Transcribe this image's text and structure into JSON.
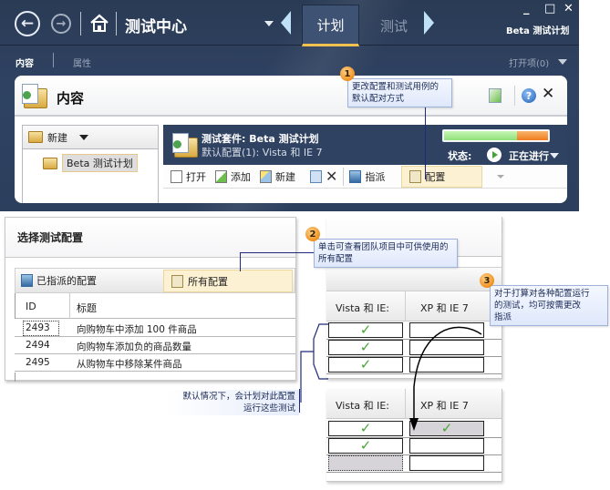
{
  "titlebar": {
    "back_icon": "arrow-left-circle-icon",
    "forward_icon": "arrow-right-circle-icon",
    "home_icon": "home-icon",
    "app_title": "测试中心",
    "tabs": [
      {
        "label": "计划",
        "active": true
      },
      {
        "label": "测试",
        "active": false
      }
    ],
    "window_controls": {
      "minimize": "_",
      "maximize": "□",
      "close": "✕"
    },
    "plan_name": "Beta 测试计划"
  },
  "subnav": {
    "tabs": [
      {
        "label": "内容",
        "active": true
      },
      {
        "label": "属性",
        "active": false
      }
    ],
    "open_items": "打开项(0)"
  },
  "content_panel": {
    "title": "内容",
    "tree": {
      "new_label": "新建",
      "items": [
        {
          "label": "Beta 测试计划",
          "selected": true
        }
      ]
    },
    "suite": {
      "title": "测试套件: Beta 测试计划",
      "subtitle": "默认配置(1): Vista 和 IE 7",
      "progress": {
        "passed_fraction": 0.7,
        "remaining_fraction": 0.3,
        "passed_color": "#8fe07a",
        "remaining_color": "#f07c1f"
      },
      "status_label": "状态:",
      "status_value": "正在进行",
      "toolbar": [
        {
          "label": "打开",
          "icon": "open-icon"
        },
        {
          "label": "添加",
          "icon": "add-icon"
        },
        {
          "label": "新建",
          "icon": "new-icon"
        },
        {
          "label": "",
          "icon": "copy-icon"
        },
        {
          "label": "",
          "icon": "delete-icon"
        },
        {
          "label": "指派",
          "icon": "assign-icon"
        },
        {
          "label": "配置",
          "icon": "configure-icon"
        }
      ]
    }
  },
  "callouts": [
    {
      "number": "1",
      "text_line1": "更改配置和测试用例的",
      "text_line2": "默认配对方式"
    },
    {
      "number": "2",
      "text_line1": "单击可查看团队项目中可供使用的",
      "text_line2": "所有配置"
    },
    {
      "number": "3",
      "text_line1": "对于打算对各种配置运行",
      "text_line2": "的测试，均可按需更改",
      "text_line3": "指派"
    }
  ],
  "default_note": {
    "line1": "默认情况下，会计划对此配置",
    "line2": "运行这些测试"
  },
  "select_config_dialog": {
    "title": "选择测试配置",
    "segments": [
      {
        "label": "已指派的配置",
        "active": false
      },
      {
        "label": "所有配置",
        "active": true
      }
    ],
    "columns": [
      "ID",
      "标题"
    ],
    "rows": [
      {
        "id": "2493",
        "title": "向购物车中添加 100 件商品",
        "focused": true
      },
      {
        "id": "2494",
        "title": "向购物车添加负的商品数量",
        "focused": false
      },
      {
        "id": "2495",
        "title": "从购物车中移除某件商品",
        "focused": false
      }
    ]
  },
  "config_grid_before": {
    "columns": [
      "Vista 和 IE:",
      "XP 和 IE 7"
    ],
    "rows": [
      {
        "vista": true,
        "xp": false
      },
      {
        "vista": true,
        "xp": false
      },
      {
        "vista": true,
        "xp": false
      }
    ]
  },
  "config_grid_after": {
    "columns": [
      "Vista 和 IE:",
      "XP 和 IE 7"
    ],
    "rows": [
      {
        "vista": true,
        "xp": true
      },
      {
        "vista": true,
        "xp": false
      },
      {
        "vista": false,
        "xp": false
      }
    ],
    "check_symbol": "✓"
  }
}
